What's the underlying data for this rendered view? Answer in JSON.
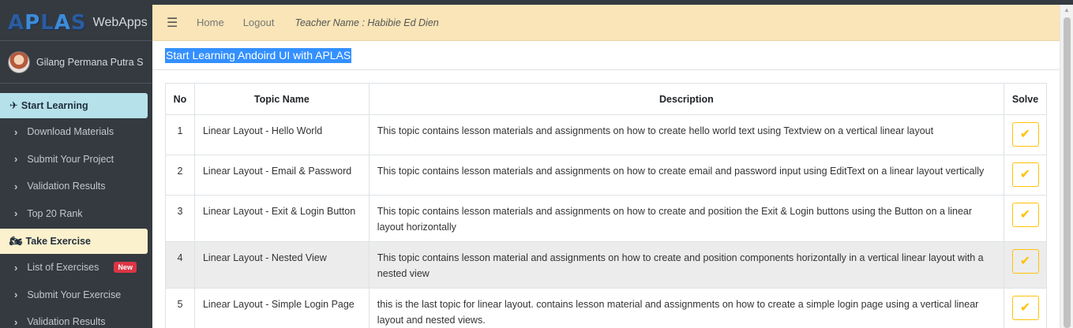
{
  "brand": {
    "logo": "APLAS",
    "logo_parts": [
      "A",
      "P",
      "L",
      "A",
      "S"
    ],
    "name": "WebApps"
  },
  "user": {
    "name": "Gilang Permana Putra S"
  },
  "sidebar": {
    "learning_header": "Start Learning",
    "learning_icon": "jet-icon",
    "learning_items": [
      "Download Materials",
      "Submit Your Project",
      "Validation Results",
      "Top 20 Rank"
    ],
    "exercise_header": "Take Exercise",
    "exercise_icon": "motorcycle-icon",
    "exercise_items": [
      "List of Exercises",
      "Submit Your Exercise",
      "Validation Results"
    ],
    "new_badge": "New"
  },
  "navbar": {
    "menu_icon": "hamburger-icon",
    "home": "Home",
    "logout": "Logout",
    "teacher": "Teacher Name : Habibie Ed Dien"
  },
  "page": {
    "title": "Start Learning Andoird UI with APLAS"
  },
  "table": {
    "headers": [
      "No",
      "Topic Name",
      "Description",
      "Solve"
    ],
    "rows": [
      {
        "no": "1",
        "topic": "Linear Layout - Hello World",
        "description": "This topic contains lesson materials and assignments on how to create hello world text using Textview on a vertical linear layout"
      },
      {
        "no": "2",
        "topic": "Linear Layout - Email & Password",
        "description": "This topic contains lesson materials and assignments on how to create email and password input using EditText on a linear layout vertically"
      },
      {
        "no": "3",
        "topic": "Linear Layout - Exit & Login Button",
        "description": "This topic contains lesson materials and assignments on how to create and position the Exit & Login buttons using the Button on a linear layout horizontally"
      },
      {
        "no": "4",
        "topic": "Linear Layout - Nested View",
        "description": "This topic contains lesson material and assignments on how to create and position components horizontally in a vertical linear layout with a nested view"
      },
      {
        "no": "5",
        "topic": "Linear Layout - Simple Login Page",
        "description": "this is the last topic for linear layout. contains lesson material and assignments on how to create a simple login page using a vertical linear layout and nested views."
      }
    ],
    "solve_icon": "check-icon"
  },
  "colors": {
    "sidebar_bg": "#343a40",
    "navbar_bg": "#f9e5b7",
    "learning_header_bg": "#b6e1ea",
    "exercise_header_bg": "#fcf1cd",
    "solve_button": "#ffc107",
    "badge": "#dc3545",
    "title_highlight": "#3390ff"
  }
}
